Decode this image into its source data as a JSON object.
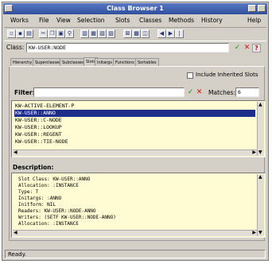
{
  "window": {
    "title": "Class Browser 1"
  },
  "menu": [
    "Works",
    "File",
    "View",
    "Selection",
    "Slots",
    "Classes",
    "Methods",
    "History",
    "Help"
  ],
  "toolbar": {
    "icons": [
      "new-icon",
      "save-icon",
      "print-icon",
      "cut-icon",
      "copy-icon",
      "paste-icon",
      "find-icon",
      "replace-icon",
      "go-icon",
      "inspect-icon",
      "window-icon",
      "split-icon",
      "back-icon",
      "forward-icon",
      "pipe-icon"
    ]
  },
  "class_field": {
    "label": "Class:",
    "value": "KW-USER:NODE"
  },
  "tabs": [
    "Hierarchy",
    "Superclasses",
    "Subclasses",
    "Slots",
    "Initargs",
    "Functions",
    "Sortables"
  ],
  "include_inherited": {
    "label": "Include Inherited Slots",
    "checked": false
  },
  "filter": {
    "label": "Filter:",
    "value": "",
    "matches_label": "Matches:",
    "matches_value": "6"
  },
  "slots": [
    {
      "text": "KW-ACTIVE-ELEMENT-P",
      "selected": false
    },
    {
      "text": "KW-USER::ANNO",
      "selected": true
    },
    {
      "text": "KW-USER::C-NODE",
      "selected": false
    },
    {
      "text": "KW-USER::LOOKUP",
      "selected": false
    },
    {
      "text": "KW-USER::REGENT",
      "selected": false
    },
    {
      "text": "KW-USER::TIE-NODE",
      "selected": false
    }
  ],
  "description": {
    "label": "Description:",
    "lines": [
      "Slot Class: KW-USER::ANNO",
      "  Allocation: :INSTANCE",
      "  Type: T",
      "  Initargs: :ANNO",
      "  Initform: NIL",
      "  Readers: KW-USER::NODE-ANNO",
      "  Writers: (SETF KW-USER::NODE-ANNO)",
      "  Allocation: :INSTANCE"
    ]
  },
  "status": {
    "text": "Ready."
  }
}
